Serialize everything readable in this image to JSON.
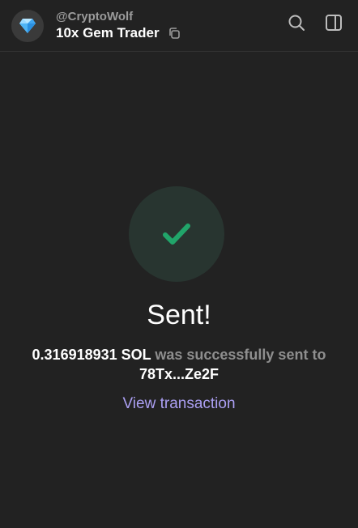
{
  "header": {
    "username": "@CryptoWolf",
    "account_name": "10x Gem Trader",
    "avatar_icon": "gem-icon",
    "copy_icon": "copy-icon",
    "search_icon": "search-icon",
    "panel_icon": "sidebar-panel-icon"
  },
  "status": {
    "icon": "checkmark-icon",
    "title": "Sent!",
    "amount": "0.316918931 SOL",
    "message_middle": "was successfully sent",
    "message_to": "to",
    "recipient": "78Tx...Ze2F",
    "view_link": "View transaction"
  },
  "colors": {
    "background": "#222222",
    "success_green": "#21a56a",
    "link_purple": "#ab9ff2"
  }
}
